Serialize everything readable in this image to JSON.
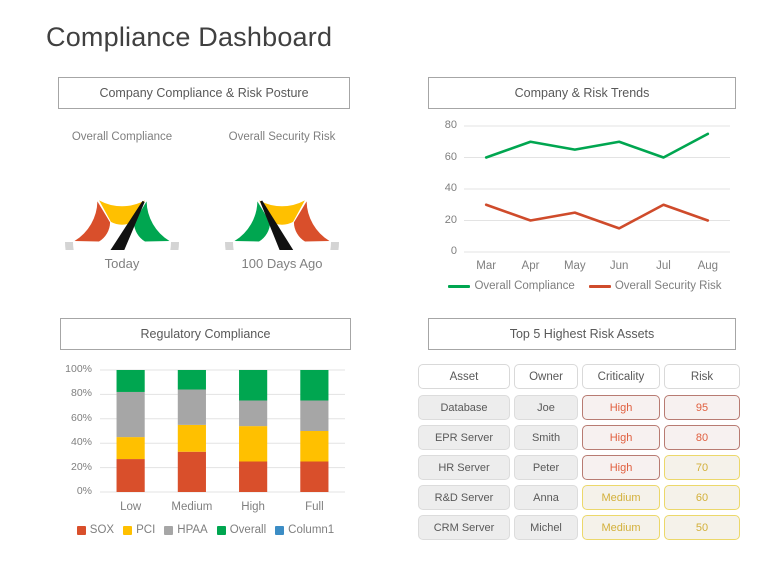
{
  "title": "Compliance Dashboard",
  "panels": {
    "posture": {
      "header": "Company Compliance & Risk Posture"
    },
    "trends": {
      "header": "Company & Risk Trends"
    },
    "regulatory": {
      "header": "Regulatory Compliance"
    },
    "risk_assets": {
      "header": "Top 5 Highest Risk Assets"
    }
  },
  "gauges": [
    {
      "label": "Overall Compliance",
      "caption": "Today",
      "needle_deg": 62,
      "order": [
        "red",
        "yellow",
        "green"
      ]
    },
    {
      "label": "Overall Security Risk",
      "caption": "100 Days Ago",
      "needle_deg": 117,
      "order": [
        "green",
        "yellow",
        "red"
      ]
    }
  ],
  "colors": {
    "green": "#00A650",
    "yellow": "#FFC000",
    "red": "#D94F2B",
    "gray": "#A6A6A6",
    "blue": "#3C8DC5",
    "ring": "#D4D4D4",
    "border": "#A6A6A6"
  },
  "chart_data": [
    {
      "type": "line",
      "title": "Company & Risk Trends",
      "xlabel": "",
      "ylabel": "",
      "categories": [
        "Mar",
        "Apr",
        "May",
        "Jun",
        "Jul",
        "Aug"
      ],
      "yticks": [
        "0",
        "20",
        "40",
        "60",
        "80"
      ],
      "ylim": [
        0,
        80
      ],
      "grid": true,
      "legend_position": "bottom",
      "series": [
        {
          "name": "Overall Compliance",
          "color": "#00A650",
          "values": [
            60,
            70,
            65,
            70,
            60,
            75
          ]
        },
        {
          "name": "Overall Security Risk",
          "color": "#CF4B2B",
          "values": [
            30,
            20,
            25,
            15,
            30,
            20
          ]
        }
      ]
    },
    {
      "type": "bar",
      "title": "Regulatory Compliance",
      "stacked": true,
      "xlabel": "",
      "ylabel": "",
      "categories": [
        "Low",
        "Medium",
        "High",
        "Full"
      ],
      "yticks": [
        "0%",
        "20%",
        "40%",
        "60%",
        "80%",
        "100%"
      ],
      "ylim": [
        0,
        100
      ],
      "grid": true,
      "legend_position": "bottom",
      "series": [
        {
          "name": "SOX",
          "color": "#D94F2B",
          "values": [
            27,
            33,
            25,
            25
          ]
        },
        {
          "name": "PCI",
          "color": "#FFC000",
          "values": [
            18,
            22,
            29,
            25
          ]
        },
        {
          "name": "HPAA",
          "color": "#A6A6A6",
          "values": [
            37,
            29,
            21,
            25
          ]
        },
        {
          "name": "Overall",
          "color": "#00A650",
          "values": [
            18,
            16,
            25,
            25
          ]
        },
        {
          "name": "Column1",
          "color": "#3C8DC5",
          "values": [
            0,
            0,
            0,
            0
          ]
        }
      ]
    }
  ],
  "risk_table": {
    "columns": [
      "Asset",
      "Owner",
      "Criticality",
      "Risk"
    ],
    "rows": [
      {
        "asset": "Database",
        "owner": "Joe",
        "criticality": "High",
        "criticality_level": "red",
        "risk": "95",
        "risk_level": "red"
      },
      {
        "asset": "EPR Server",
        "owner": "Smith",
        "criticality": "High",
        "criticality_level": "red",
        "risk": "80",
        "risk_level": "red"
      },
      {
        "asset": "HR Server",
        "owner": "Peter",
        "criticality": "High",
        "criticality_level": "red",
        "risk": "70",
        "risk_level": "yellow"
      },
      {
        "asset": "R&D  Server",
        "owner": "Anna",
        "criticality": "Medium",
        "criticality_level": "yellow",
        "risk": "60",
        "risk_level": "yellow"
      },
      {
        "asset": "CRM Server",
        "owner": "Michel",
        "criticality": "Medium",
        "criticality_level": "yellow",
        "risk": "50",
        "risk_level": "yellow"
      }
    ]
  }
}
